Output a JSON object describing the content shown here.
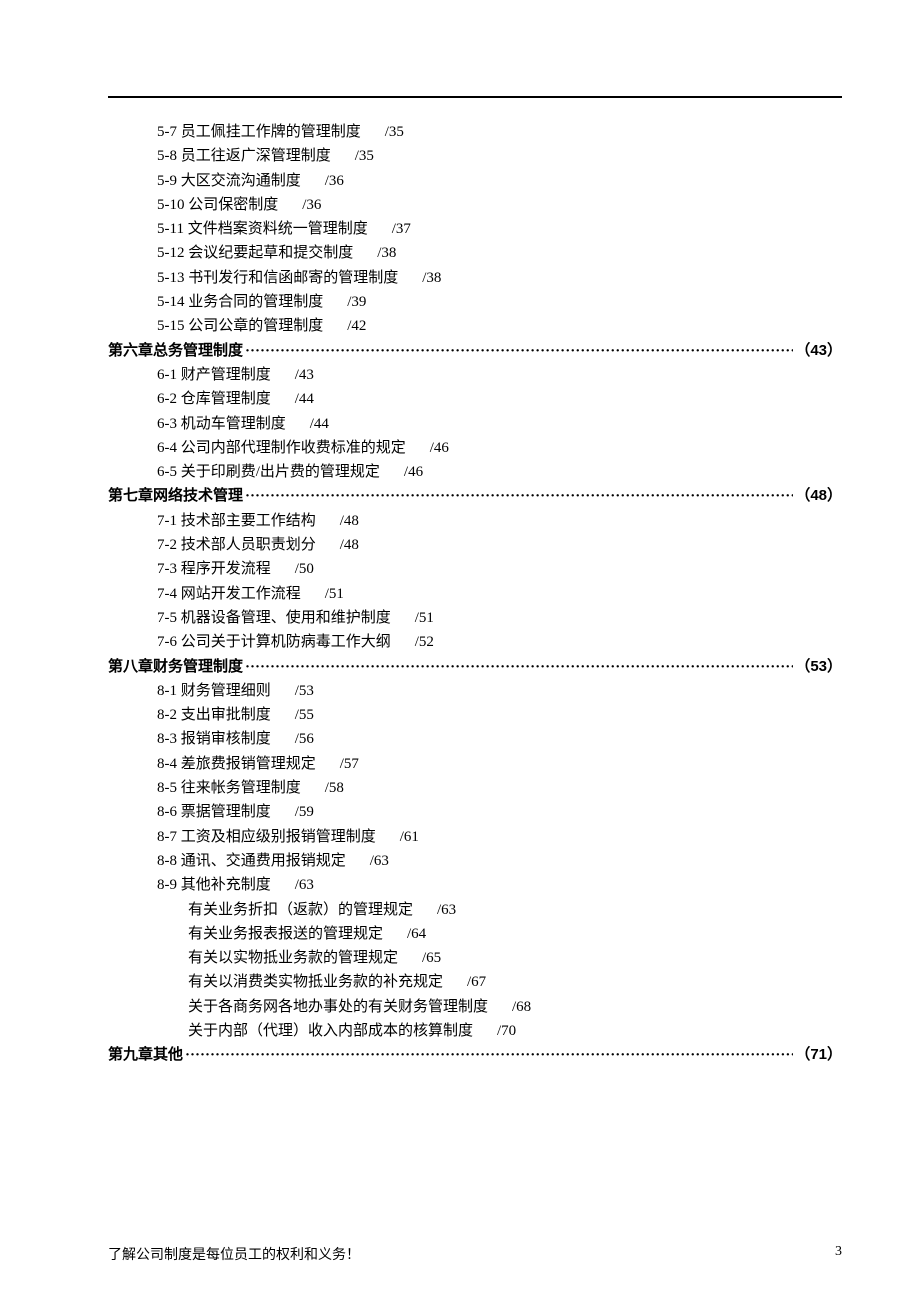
{
  "footer": {
    "text": "了解公司制度是每位员工的权利和义务！",
    "page": "3"
  },
  "entries": [
    {
      "type": "item",
      "num": "5-7",
      "title": "员工佩挂工作牌的管理制度",
      "page": "/35"
    },
    {
      "type": "item",
      "num": "5-8",
      "title": "员工往返广深管理制度",
      "page": "/35"
    },
    {
      "type": "item",
      "num": "5-9",
      "title": "大区交流沟通制度",
      "page": "/36"
    },
    {
      "type": "item",
      "num": "5-10",
      "title": "公司保密制度",
      "page": "/36"
    },
    {
      "type": "item",
      "num": "5-11",
      "title": "文件档案资料统一管理制度",
      "page": "/37"
    },
    {
      "type": "item",
      "num": "5-12",
      "title": "会议纪要起草和提交制度",
      "page": "/38"
    },
    {
      "type": "item",
      "num": "5-13",
      "title": "书刊发行和信函邮寄的管理制度",
      "page": "/38"
    },
    {
      "type": "item",
      "num": "5-14",
      "title": "业务合同的管理制度",
      "page": "/39"
    },
    {
      "type": "item",
      "num": "5-15",
      "title": "公司公章的管理制度",
      "page": "/42"
    },
    {
      "type": "chapter",
      "label": "第六章",
      "title": "总务管理制度",
      "page": "（43）"
    },
    {
      "type": "item",
      "num": "6-1",
      "title": "财产管理制度",
      "page": "/43"
    },
    {
      "type": "item",
      "num": "6-2",
      "title": "仓库管理制度",
      "page": "/44"
    },
    {
      "type": "item",
      "num": "6-3",
      "title": "机动车管理制度",
      "page": "/44"
    },
    {
      "type": "item",
      "num": "6-4",
      "title": "公司内部代理制作收费标准的规定",
      "page": "/46"
    },
    {
      "type": "item",
      "num": "6-5",
      "title": "关于印刷费/出片费的管理规定",
      "page": "/46"
    },
    {
      "type": "chapter",
      "label": "第七章",
      "title": "网络技术管理",
      "page": "（48）"
    },
    {
      "type": "item",
      "num": "7-1",
      "title": "技术部主要工作结构",
      "page": "/48"
    },
    {
      "type": "item",
      "num": "7-2",
      "title": "技术部人员职责划分",
      "page": "/48"
    },
    {
      "type": "item",
      "num": "7-3",
      "title": "程序开发流程",
      "page": "/50"
    },
    {
      "type": "item",
      "num": "7-4",
      "title": "网站开发工作流程",
      "page": "/51"
    },
    {
      "type": "item",
      "num": "7-5",
      "title": "机器设备管理、使用和维护制度",
      "page": "/51"
    },
    {
      "type": "item",
      "num": "7-6",
      "title": "公司关于计算机防病毒工作大纲",
      "page": "/52"
    },
    {
      "type": "chapter",
      "label": "第八章",
      "title": "财务管理制度",
      "page": "（53）"
    },
    {
      "type": "item",
      "num": "8-1",
      "title": "财务管理细则",
      "page": "/53"
    },
    {
      "type": "item",
      "num": "8-2",
      "title": "支出审批制度",
      "page": "/55"
    },
    {
      "type": "item",
      "num": "8-3",
      "title": "报销审核制度",
      "page": "/56"
    },
    {
      "type": "item",
      "num": "8-4",
      "title": "差旅费报销管理规定",
      "page": "/57"
    },
    {
      "type": "item",
      "num": "8-5",
      "title": "往来帐务管理制度",
      "page": "/58"
    },
    {
      "type": "item",
      "num": "8-6",
      "title": "票据管理制度",
      "page": "/59"
    },
    {
      "type": "item",
      "num": "8-7",
      "title": "工资及相应级别报销管理制度",
      "page": "/61"
    },
    {
      "type": "item",
      "num": "8-8",
      "title": "通讯、交通费用报销规定",
      "page": "/63"
    },
    {
      "type": "item",
      "num": "8-9",
      "title": "其他补充制度",
      "page": "/63"
    },
    {
      "type": "sub",
      "title": "有关业务折扣（返款）的管理规定",
      "page": "/63"
    },
    {
      "type": "sub",
      "title": "有关业务报表报送的管理规定",
      "page": "/64"
    },
    {
      "type": "sub",
      "title": "有关以实物抵业务款的管理规定",
      "page": "/65"
    },
    {
      "type": "sub",
      "title": "有关以消费类实物抵业务款的补充规定",
      "page": "/67"
    },
    {
      "type": "sub",
      "title": "关于各商务网各地办事处的有关财务管理制度",
      "page": "/68"
    },
    {
      "type": "sub",
      "title": "关于内部（代理）收入内部成本的核算制度",
      "page": "/70"
    },
    {
      "type": "chapter",
      "label": "第九章",
      "title": "其他",
      "page": "（71）"
    }
  ]
}
